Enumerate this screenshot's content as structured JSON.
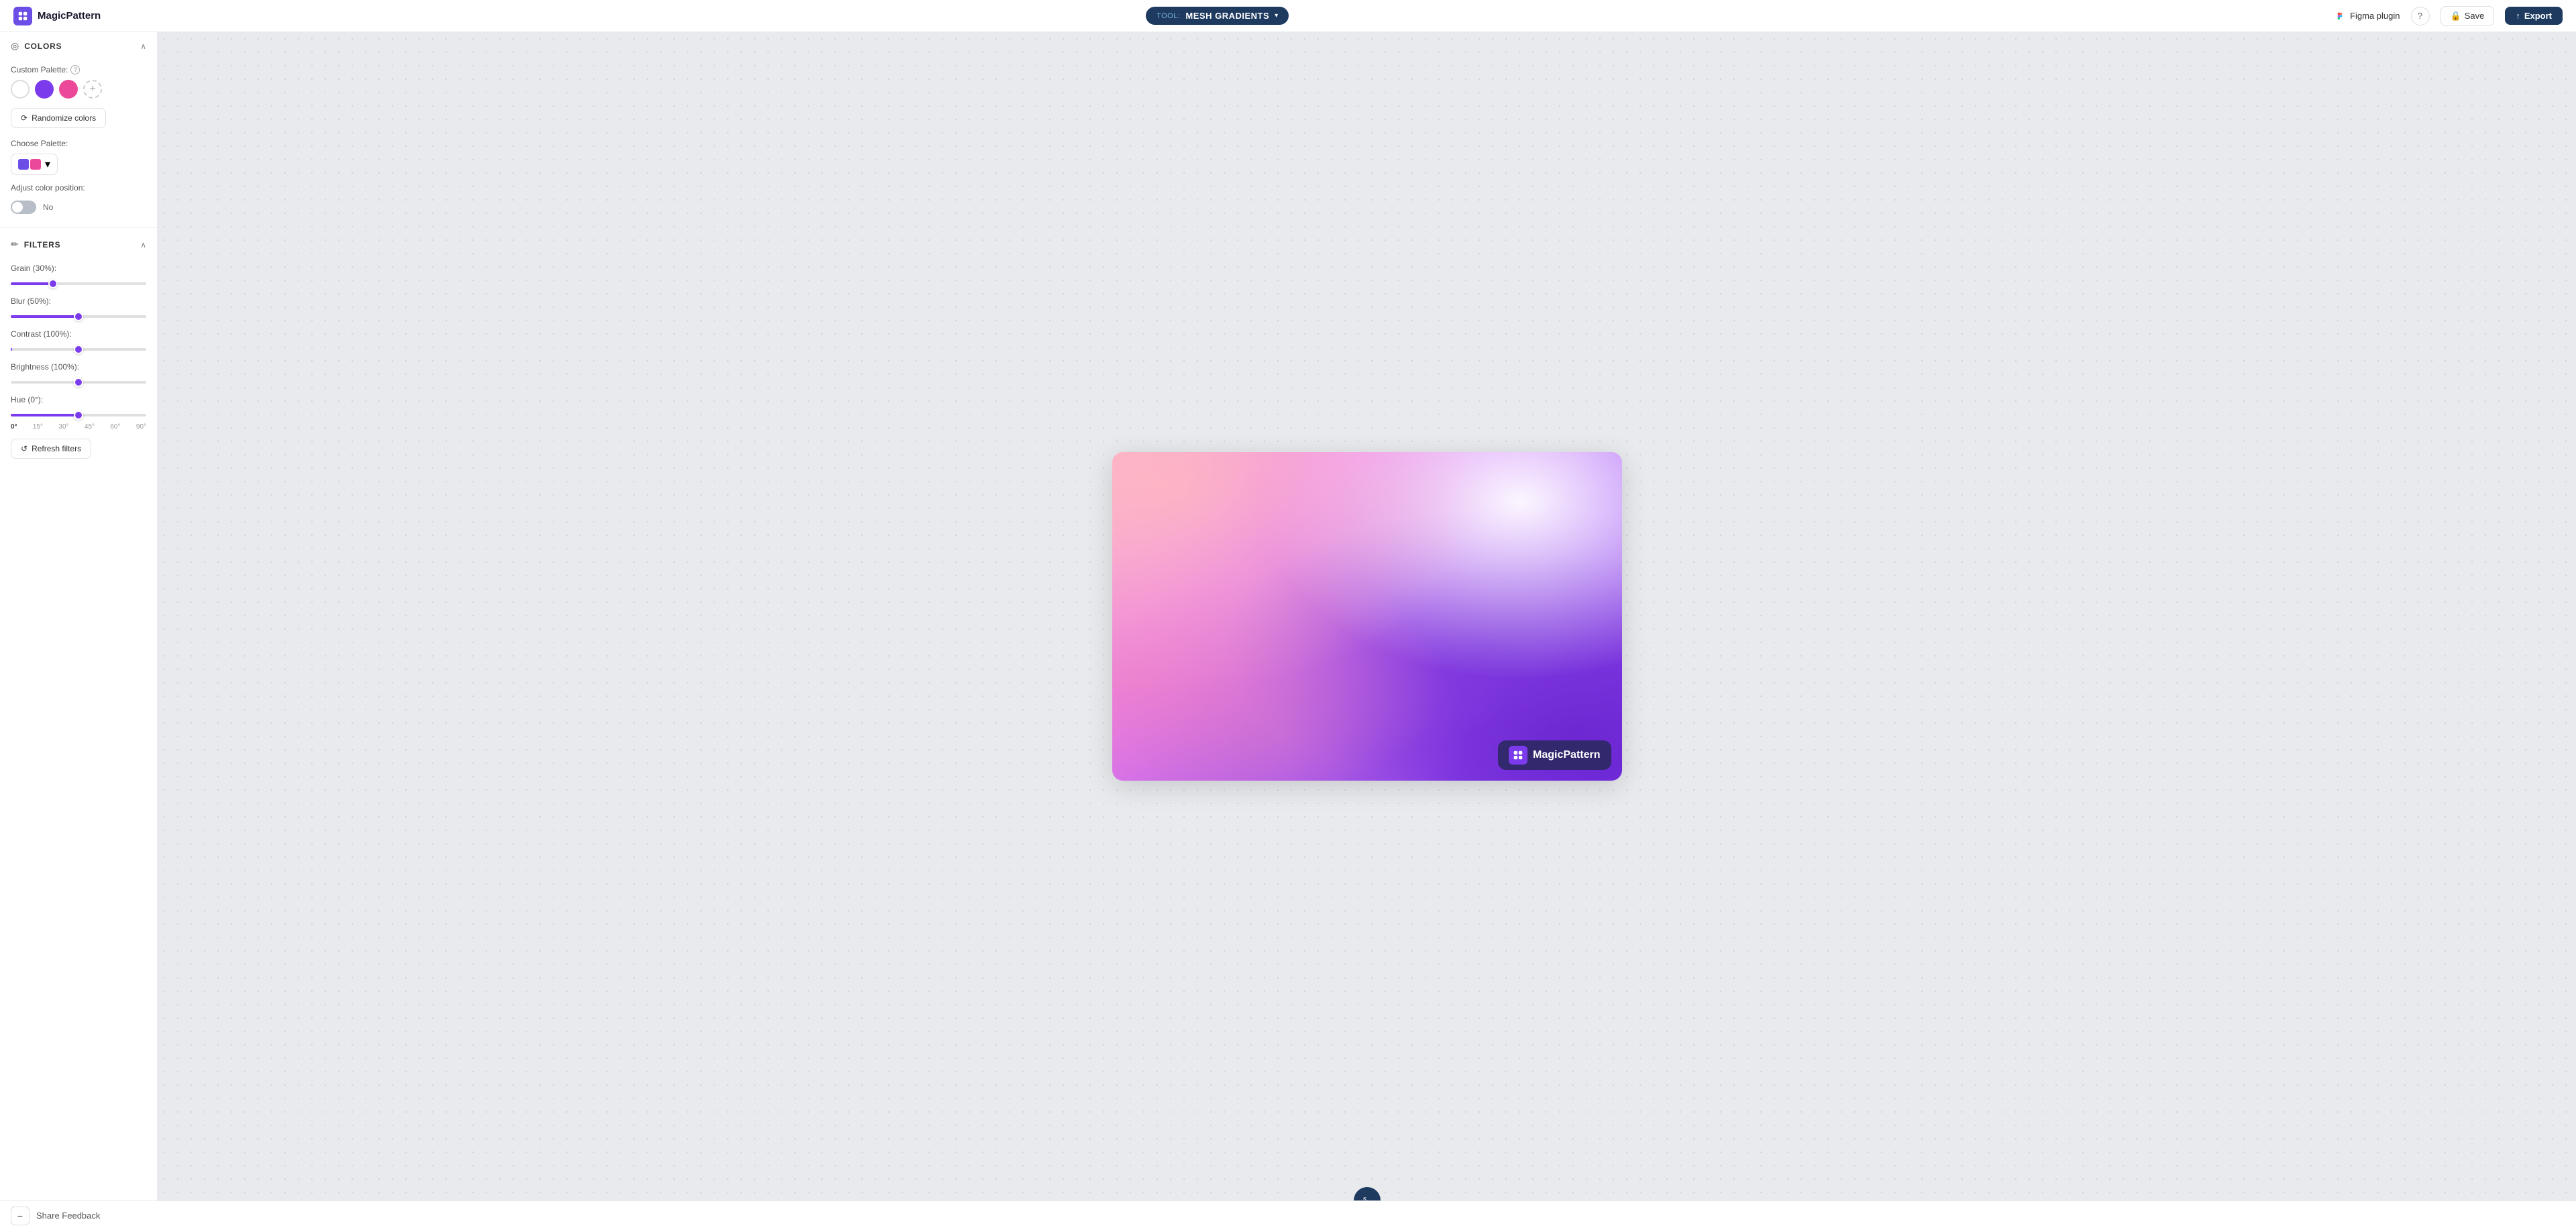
{
  "brand": {
    "name": "MagicPattern",
    "logo_color": "#6c4de6"
  },
  "topbar": {
    "tool_label": "TOOL:",
    "tool_name": "MESH GRADIENTS",
    "figma_plugin_label": "Figma plugin",
    "help_tooltip": "?",
    "save_label": "Save",
    "export_label": "Export"
  },
  "sidebar": {
    "colors_section": {
      "title": "COLORS",
      "custom_palette_label": "Custom Palette:",
      "swatches": [
        {
          "color": "#ffffff",
          "label": "white"
        },
        {
          "color": "#7c3aed",
          "label": "purple"
        },
        {
          "color": "#ec4899",
          "label": "pink"
        }
      ],
      "randomize_label": "Randomize colors",
      "choose_palette_label": "Choose Palette:",
      "palette_colors": [
        "#6c4de6",
        "#ec4899"
      ],
      "adjust_position_label": "Adjust color position:",
      "toggle_state": "No"
    },
    "filters_section": {
      "title": "FILTERS",
      "grain_label": "Grain (30%):",
      "grain_value": 30,
      "blur_label": "Blur (50%):",
      "blur_value": 50,
      "contrast_label": "Contrast (100%):",
      "contrast_value": 100,
      "brightness_label": "Brightness (100%):",
      "brightness_value": 100,
      "hue_label": "Hue (0°):",
      "hue_value": 0,
      "hue_ticks": [
        "0°",
        "15°",
        "30°",
        "45°",
        "60°",
        "90°"
      ],
      "refresh_label": "Refresh filters"
    }
  },
  "canvas": {
    "watermark_text": "MagicPattern"
  },
  "bottombar": {
    "feedback_text": "Share Feedback"
  },
  "icons": {
    "refresh": "↺",
    "randomize": "⟳",
    "export_arrow": "↑",
    "lock": "🔒",
    "resize": "⤡",
    "minus": "−",
    "chevron_down": "▾",
    "collapse": "∧",
    "help": "?"
  }
}
